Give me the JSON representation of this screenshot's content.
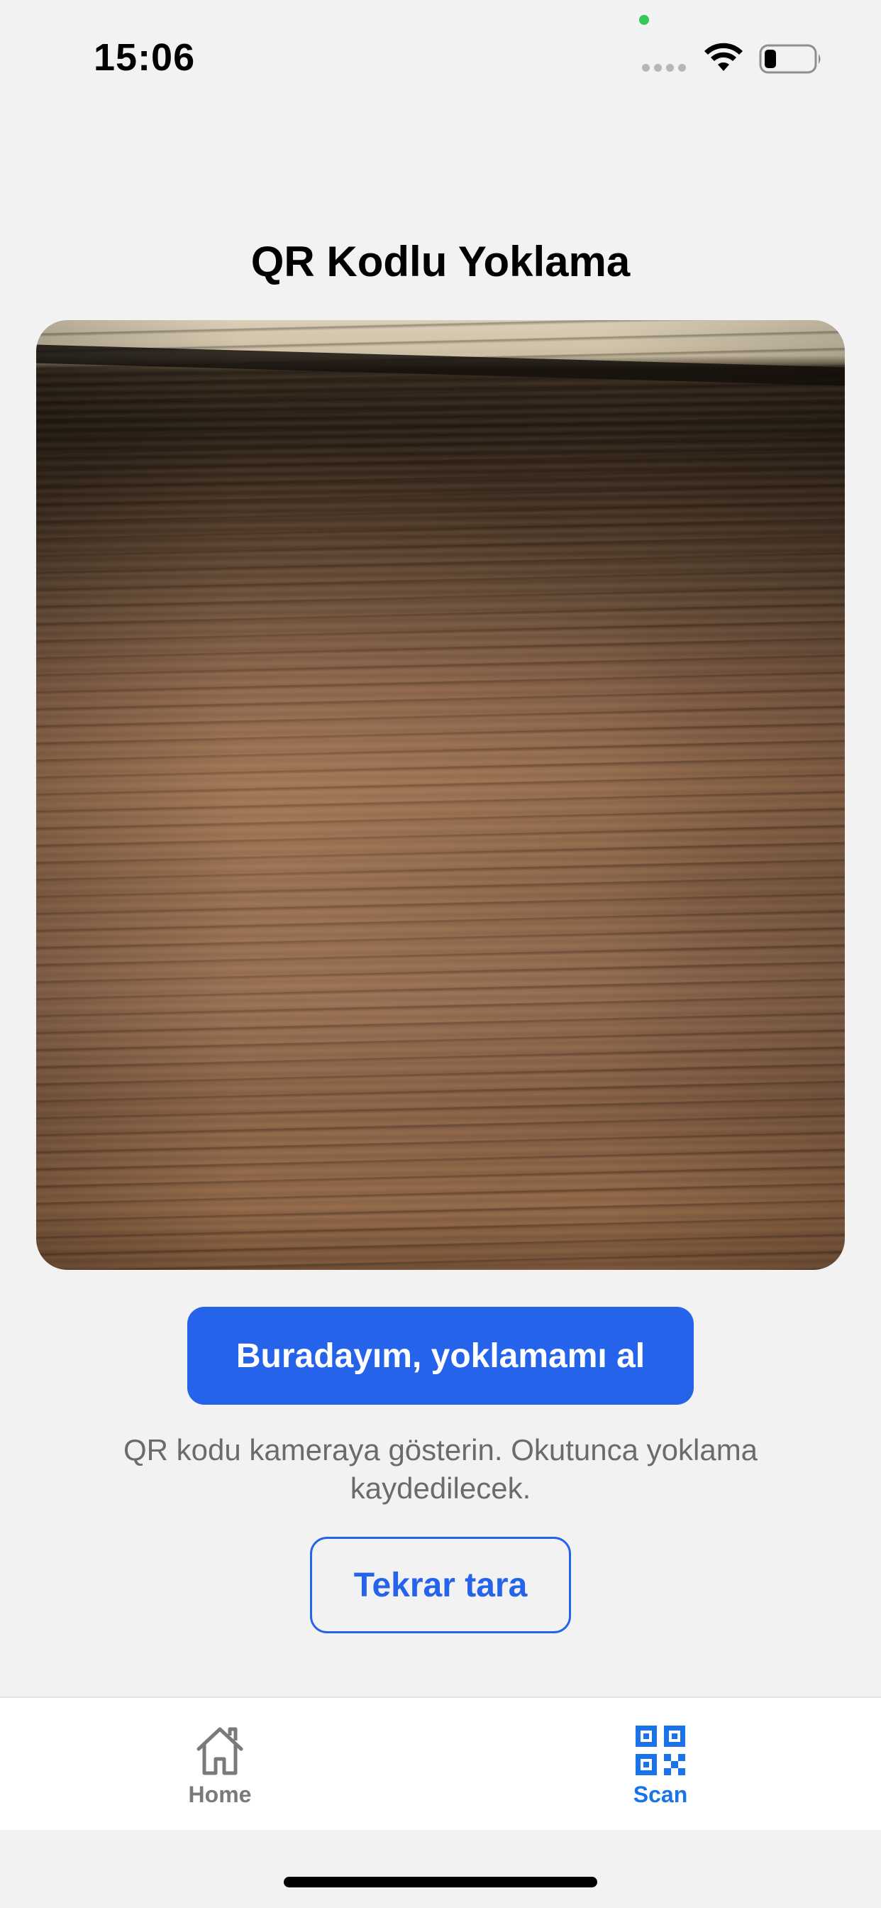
{
  "status_bar": {
    "time": "15:06",
    "icons": [
      "privacy-indicator-dot",
      "cellular-signal-icon",
      "wifi-icon",
      "battery-icon"
    ],
    "privacy_dot_color": "#34c759"
  },
  "page": {
    "title": "QR Kodlu Yoklama"
  },
  "camera": {
    "preview": "camera-viewfinder"
  },
  "actions": {
    "primary_label": "Buradayım, yoklamamı al",
    "hint": "QR kodu kameraya gösterin. Okutunca yoklama kaydedilecek.",
    "secondary_label": "Tekrar tara"
  },
  "tab_bar": {
    "items": [
      {
        "label": "Home",
        "icon": "home-icon",
        "active": false
      },
      {
        "label": "Scan",
        "icon": "qr-code-icon",
        "active": true
      }
    ]
  },
  "colors": {
    "accent": "#2563eb",
    "tab_active": "#1a73e8",
    "tab_inactive": "#7a7a7a",
    "background": "#f2f2f2"
  }
}
